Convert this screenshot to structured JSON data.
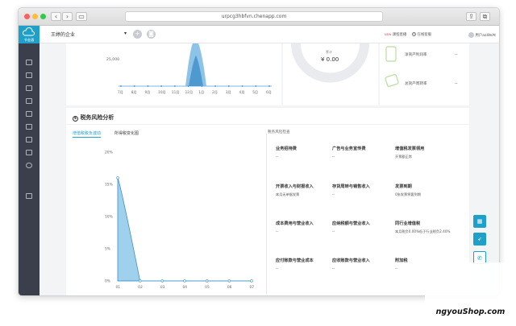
{
  "browser": {
    "url": "urpcg3hbfvn.chenapp.com"
  },
  "sidebar": {
    "logo_label": "节金通"
  },
  "topbar": {
    "company_name": "王婷的企业",
    "caret": "▾",
    "add_icon": "plus-icon",
    "account_icon": "account-icon",
    "links": [
      {
        "label": "课程直播",
        "badge": "NEW"
      },
      {
        "label": "在线客服"
      },
      {
        "label": "用户aaWeAt"
      }
    ]
  },
  "top_panel": {
    "area_chart": {
      "y_ticks": [
        "25,000"
      ],
      "x_ticks": [
        "7月",
        "8月",
        "9月",
        "10月",
        "11月",
        "12月",
        "1月",
        "2月",
        "3月",
        "4月",
        "5月",
        "6月"
      ]
    },
    "donut": {
      "label": "累计",
      "value": "¥ 0.00"
    },
    "metrics": [
      {
        "label": "净资产利润率",
        "value": "--"
      },
      {
        "label": "总资产周转率",
        "value": "--"
      }
    ]
  },
  "tax_risk": {
    "title": "税务风险分析",
    "tabs": [
      "增值税税负波动",
      "所得税变化图"
    ],
    "active_tab": 0,
    "risk_check_label": "税务风险检查",
    "items": [
      {
        "title": "业务招待费",
        "value": "--"
      },
      {
        "title": "广告与业务宣传费",
        "value": "--"
      },
      {
        "title": "增值税发票领用",
        "value": "开票额正常"
      },
      {
        "title": "开票收入与财报收入",
        "value": "本月无单据发票"
      },
      {
        "title": "存货周转与销售收入",
        "value": "--"
      },
      {
        "title": "发票到期",
        "value": "0张发票将要到期"
      },
      {
        "title": "成本费用与营业收入",
        "value": "--"
      },
      {
        "title": "应纳税额与营业收入",
        "value": "--"
      },
      {
        "title": "同行业增值税",
        "value": "本月税负0.00%低于行业税负2.40%"
      },
      {
        "title": "应付账款与营业成本",
        "value": "--"
      },
      {
        "title": "应收账款与营业收入",
        "value": "--"
      },
      {
        "title": "附加税",
        "value": "--"
      }
    ]
  },
  "chart_data": {
    "type": "area",
    "x": [
      "01",
      "02",
      "03",
      "04",
      "05",
      "06",
      "07"
    ],
    "y_ticks": [
      "20%",
      "15%",
      "10%",
      "5%",
      "0%"
    ],
    "ylim": [
      0,
      20
    ],
    "values": [
      16.0,
      0,
      0,
      0,
      0,
      0,
      0
    ],
    "color": "#5fb0e0"
  },
  "floating_buttons": [
    "qr-icon",
    "rocket-icon",
    "phone-icon"
  ],
  "watermark": {
    "text": "ngyouShop.com"
  }
}
